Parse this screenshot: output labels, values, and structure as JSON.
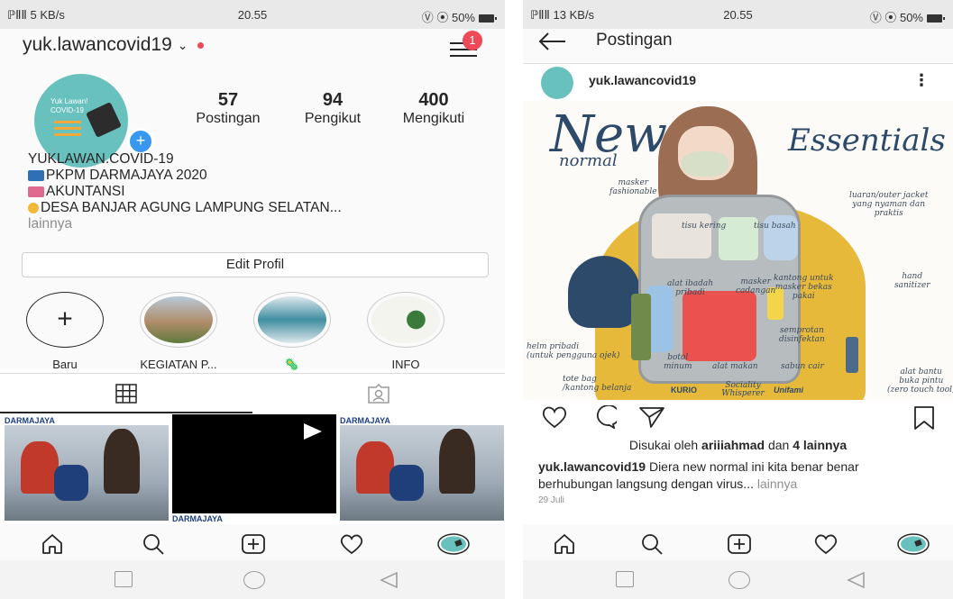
{
  "left_screen": {
    "status": {
      "signal": "ℙⅡⅡ 5 KB/s",
      "time": "20.55",
      "right": "Ⓥ ⦿ 50%"
    },
    "header": {
      "username": "yuk.lawancovid19",
      "notification_count": "1"
    },
    "avatar_text": "Yuk Lawan!\nCOVID-19",
    "stats": [
      {
        "value": "57",
        "label": "Postingan"
      },
      {
        "value": "94",
        "label": "Pengikut"
      },
      {
        "value": "400",
        "label": "Mengikuti"
      }
    ],
    "bio": {
      "name": "YUKLAWAN.COVID-19",
      "line1": "PKPM DARMAJAYA 2020",
      "line2": "AKUNTANSI",
      "line3": "DESA BANJAR AGUNG LAMPUNG SELATAN...",
      "more": "lainnya"
    },
    "edit_profile": "Edit Profil",
    "highlights": [
      {
        "label": "Baru"
      },
      {
        "label": "KEGIATAN P..."
      },
      {
        "label": "🦠"
      },
      {
        "label": "INFO"
      }
    ],
    "grid": [
      {
        "caption": "DARMAJAYA",
        "type": "photo"
      },
      {
        "caption": "",
        "type": "video"
      },
      {
        "caption": "DARMAJAYA",
        "type": "photo"
      }
    ],
    "grid_overflow_caption": "DARMAJAYA"
  },
  "right_screen": {
    "status": {
      "signal": "ℙⅡⅡ 13 KB/s",
      "time": "20.55",
      "right": "Ⓥ ⦿ 50%"
    },
    "header": {
      "title": "Postingan"
    },
    "post": {
      "username": "yuk.lawancovid19",
      "image": {
        "title_new": "New",
        "title_normal": "normal",
        "title_essentials": "Essentials",
        "labels": {
          "masker": "masker\nfashionable",
          "tisu_kering": "tisu kering",
          "tisu_basah": "tisu basah",
          "luaran": "luaran/outer jacket\nyang nyaman dan\npraktis",
          "alat_ibadah": "alat ibadah\npribadi",
          "masker_cadangan": "masker\ncadangan",
          "kantong": "kantong untuk\nmasker bekas\npakai",
          "hand_sanitizer": "hand\nsanitizer",
          "semprotan": "semprotan\ndisinfektan",
          "helm": "helm pribadi\n(untuk pengguna ojek)",
          "botol": "botol\nminum",
          "alat_makan": "alat makan",
          "sabun": "sabun cair",
          "tote": "tote bag\n/kantong belanja",
          "alat_bantu": "alat bantu\nbuka pintu\n(zero touch tool)"
        },
        "brands": [
          "KURIO",
          "Sociality Whisperer",
          "Unifami"
        ]
      },
      "likes_prefix": "Disukai oleh ",
      "likes_user": "ariiiahmad",
      "likes_mid": " dan ",
      "likes_others": "4 lainnya",
      "caption_user": "yuk.lawancovid19",
      "caption_text": " Diera new normal ini kita benar benar berhubungan langsung dengan virus...",
      "caption_more": " lainnya",
      "date": "29 Juli"
    }
  },
  "colors": {
    "accent_red": "#ed4956",
    "accent_blue": "#3897f0",
    "avatar_teal": "#69c1be"
  },
  "icons": [
    "menu-icon",
    "home-icon",
    "search-icon",
    "add-post-icon",
    "heart-icon",
    "back-arrow-icon",
    "comment-icon",
    "share-icon",
    "bookmark-icon",
    "grid-icon",
    "tagged-icon",
    "more-icon"
  ]
}
